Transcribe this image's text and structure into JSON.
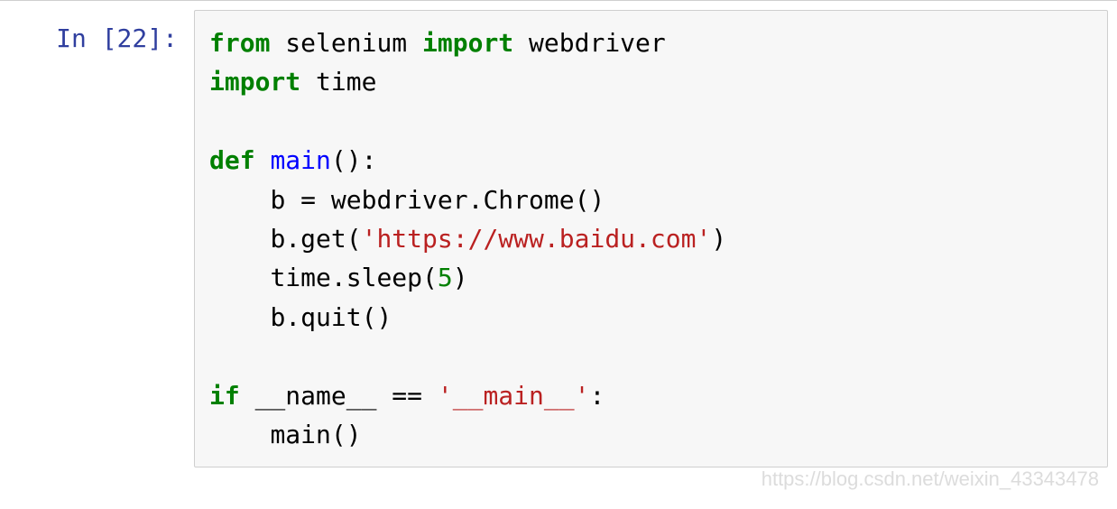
{
  "prompt": {
    "label": "In ",
    "number": "[22]",
    "colon": ":"
  },
  "code": {
    "line1": {
      "t1": "from",
      "t2": " selenium ",
      "t3": "import",
      "t4": " webdriver"
    },
    "line2": {
      "t1": "import",
      "t2": " time"
    },
    "blank1": "",
    "line3": {
      "t1": "def",
      "t2": " ",
      "t3": "main",
      "t4": "():"
    },
    "line4": {
      "indent": "    ",
      "t1": "b = webdriver.Chrome()"
    },
    "line5": {
      "indent": "    ",
      "t1": "b.get(",
      "t2": "'https://www.baidu.com'",
      "t3": ")"
    },
    "line6": {
      "indent": "    ",
      "t1": "time.sleep(",
      "t2": "5",
      "t3": ")"
    },
    "line7": {
      "indent": "    ",
      "t1": "b.quit()"
    },
    "blank2": "",
    "line8": {
      "t1": "if",
      "t2": " __name__ == ",
      "t3": "'__main__'",
      "t4": ":"
    },
    "line9": {
      "indent": "    ",
      "t1": "main()"
    }
  },
  "watermark": "https://blog.csdn.net/weixin_43343478"
}
